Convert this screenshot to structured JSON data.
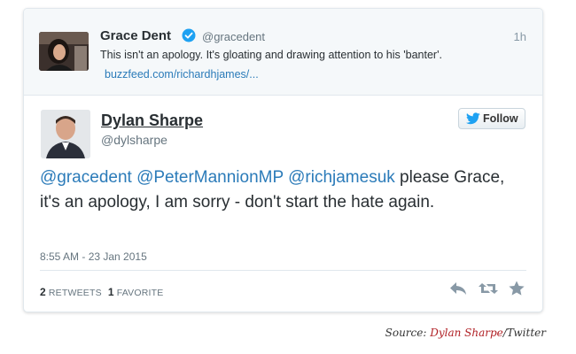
{
  "parent_tweet": {
    "name": "Grace Dent",
    "handle": "@gracedent",
    "time": "1h",
    "text": "This isn't an apology. It's gloating and drawing attention to his 'banter'.",
    "link": "buzzfeed.com/richardhjames/..."
  },
  "main_tweet": {
    "name": "Dylan Sharpe",
    "handle": "@dylsharpe",
    "follow_label": "Follow",
    "mentions": [
      "@gracedent",
      "@PeterMannionMP",
      "@richjamesuk"
    ],
    "text_rest": " please Grace, it's an apology, I am sorry - don't start the hate again.",
    "date": "8:55 AM - 23 Jan 2015",
    "retweets_count": "2",
    "retweets_label": "RETWEETS",
    "favorites_count": "1",
    "favorites_label": "FAVORITE"
  },
  "source": {
    "prefix": "Source: ",
    "author": "Dylan Sharpe",
    "suffix": "/Twitter"
  },
  "colors": {
    "link": "#2b7bb9",
    "verified": "#1da1f2",
    "source_red": "#b01f24"
  },
  "icons": [
    "verified-badge-icon",
    "twitter-bird-icon",
    "reply-icon",
    "retweet-icon",
    "favorite-star-icon"
  ]
}
